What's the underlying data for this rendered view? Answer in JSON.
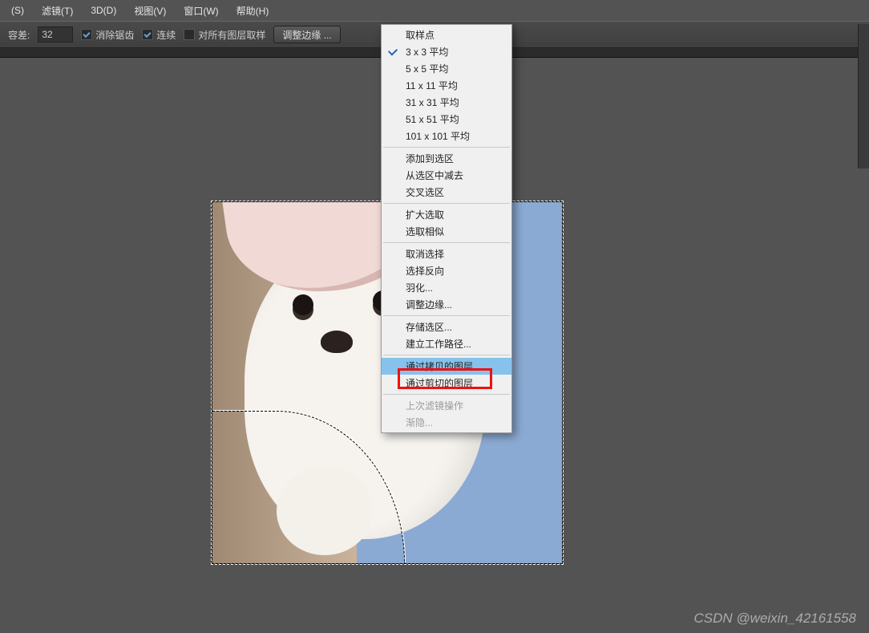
{
  "menubar": {
    "items": [
      {
        "label": "(S)"
      },
      {
        "label": "滤镜(T)"
      },
      {
        "label": "3D(D)"
      },
      {
        "label": "视图(V)"
      },
      {
        "label": "窗口(W)"
      },
      {
        "label": "帮助(H)"
      }
    ]
  },
  "toolbar": {
    "tolerance_label": "容差:",
    "tolerance_value": "32",
    "antialias_label": "消除锯齿",
    "antialias_checked": true,
    "contiguous_label": "连续",
    "contiguous_checked": true,
    "all_layers_label": "对所有图层取样",
    "all_layers_checked": false,
    "adjust_edges_label": "调整边缘 ..."
  },
  "context_menu": {
    "groups": [
      [
        {
          "label": "取样点",
          "checked": false
        },
        {
          "label": "3 x 3 平均",
          "checked": true
        },
        {
          "label": "5 x 5 平均",
          "checked": false
        },
        {
          "label": "11 x 11 平均",
          "checked": false
        },
        {
          "label": "31 x 31 平均",
          "checked": false
        },
        {
          "label": "51 x 51 平均",
          "checked": false
        },
        {
          "label": "101 x 101 平均",
          "checked": false
        }
      ],
      [
        {
          "label": "添加到选区"
        },
        {
          "label": "从选区中减去"
        },
        {
          "label": "交叉选区"
        }
      ],
      [
        {
          "label": "扩大选取"
        },
        {
          "label": "选取相似"
        }
      ],
      [
        {
          "label": "取消选择"
        },
        {
          "label": "选择反向"
        },
        {
          "label": "羽化..."
        },
        {
          "label": "调整边缘..."
        }
      ],
      [
        {
          "label": "存储选区..."
        },
        {
          "label": "建立工作路径..."
        }
      ],
      [
        {
          "label": "通过拷贝的图层",
          "highlighted": true
        },
        {
          "label": "通过剪切的图层"
        }
      ],
      [
        {
          "label": "上次滤镜操作",
          "disabled": true
        },
        {
          "label": "渐隐...",
          "disabled": true
        }
      ]
    ]
  },
  "watermark": "CSDN @weixin_42161558"
}
